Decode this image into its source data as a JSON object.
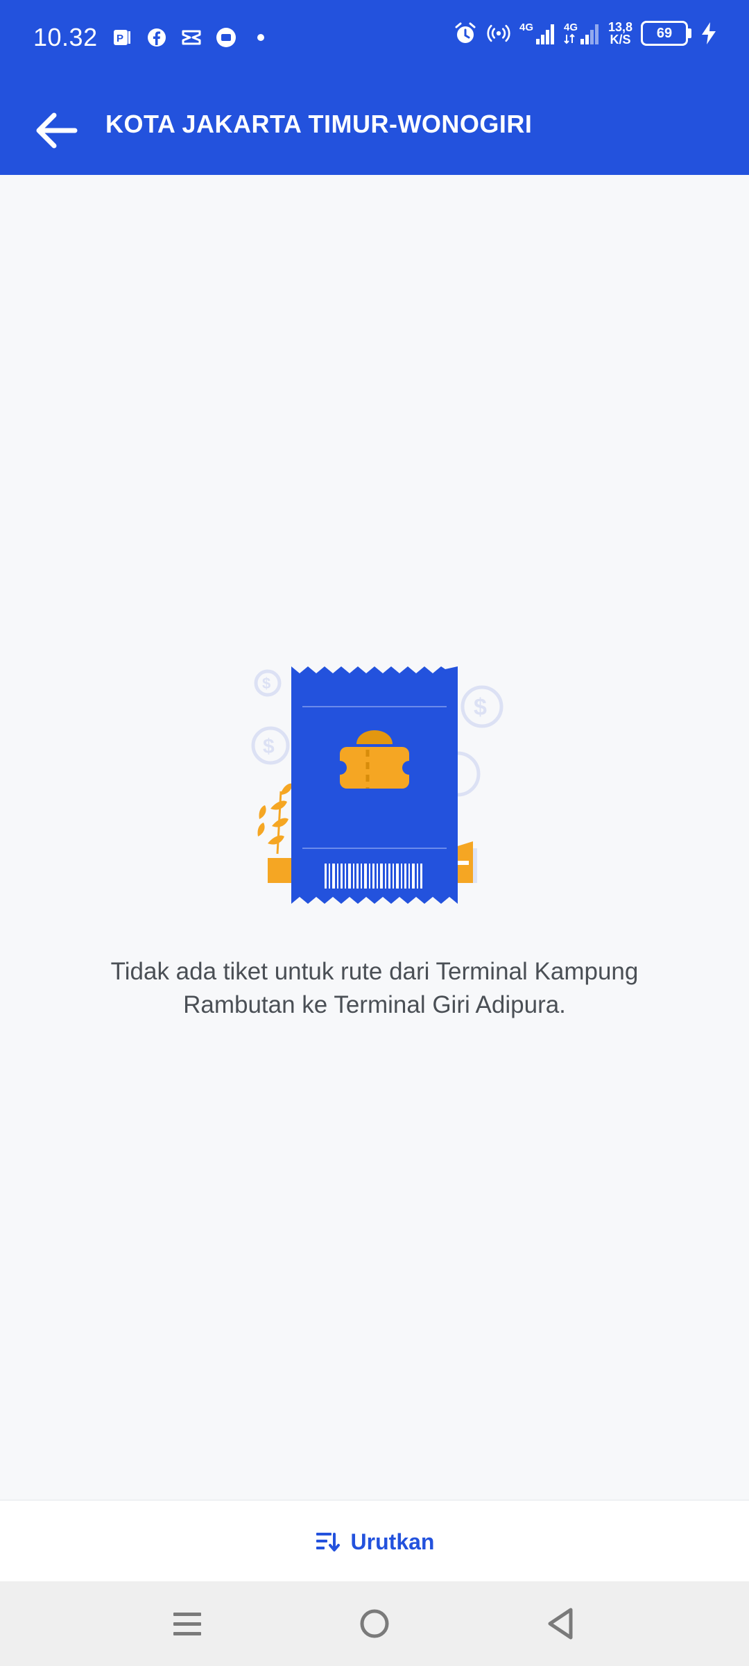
{
  "status_bar": {
    "time": "10.32",
    "network_1": "4G",
    "network_2": "4G",
    "speed_value": "13,8",
    "speed_unit": "K/S",
    "battery": "69"
  },
  "app_bar": {
    "title": "KOTA JAKARTA TIMUR-WONOGIRI"
  },
  "empty_state": {
    "message": "Tidak ada tiket untuk rute dari Terminal Kampung Rambutan ke Terminal Giri Adipura."
  },
  "sort_bar": {
    "label": "Urutkan"
  },
  "colors": {
    "primary": "#2352DD",
    "accent": "#F5A623",
    "background": "#F7F8FA"
  },
  "icons": {
    "back": "arrow-left-icon",
    "sort": "sort-icon",
    "nav_menu": "menu-icon",
    "nav_home": "home-circle-icon",
    "nav_back": "back-triangle-icon"
  }
}
